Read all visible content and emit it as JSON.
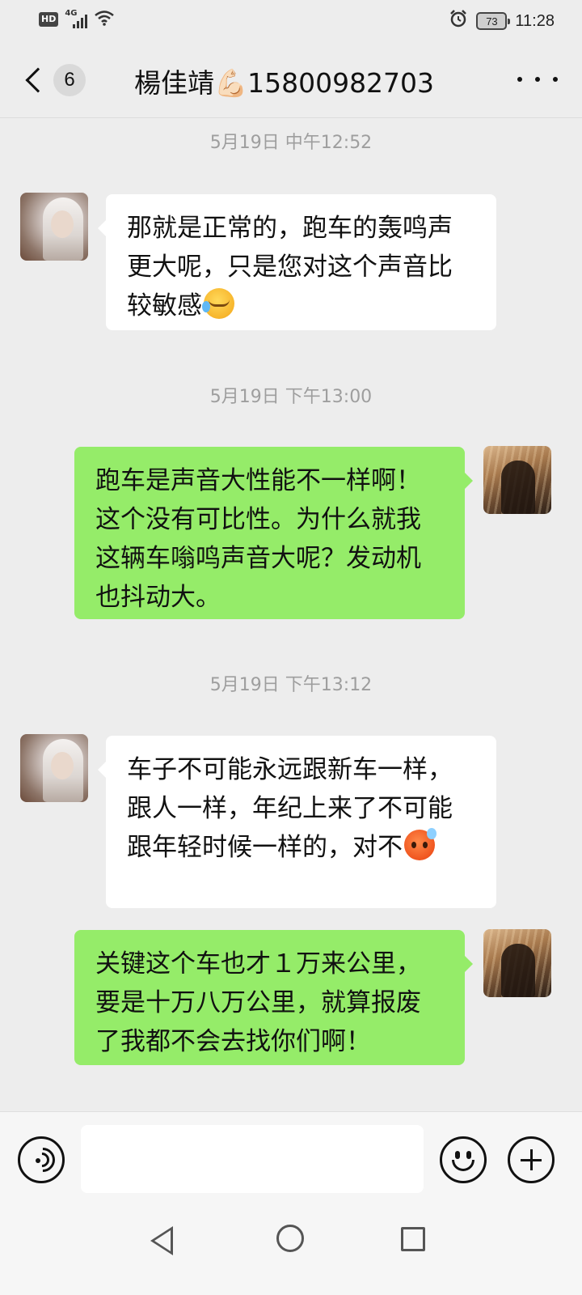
{
  "status_bar": {
    "hd": "HD",
    "network": "4G",
    "battery": "73",
    "time": "11:28"
  },
  "header": {
    "unread_count": "6",
    "title": "楊佳靖💪🏻15800982703"
  },
  "messages": [
    {
      "timestamp": "5月19日 中午12:52",
      "direction": "incoming",
      "text": "那就是正常的，跑车的轰鸣声更大呢，只是您对这个声音比较敏感",
      "emoji": "crying-laughing-emoji"
    },
    {
      "timestamp": "5月19日 下午13:00",
      "direction": "outgoing",
      "text": "跑车是声音大性能不一样啊！这个没有可比性。为什么就我这辆车嗡鸣声音大呢？发动机也抖动大。"
    },
    {
      "timestamp": "5月19日 下午13:12",
      "direction": "incoming",
      "text": "车子不可能永远跟新车一样，跟人一样，年纪上来了不可能跟年轻时候一样的，对不",
      "emoji": "sweating-angry-emoji"
    },
    {
      "direction": "outgoing",
      "text": "关键这个车也才１万来公里，要是十万八万公里，就算报废了我都不会去找你们啊！"
    }
  ],
  "colors": {
    "background": "#ededed",
    "incoming_bubble": "#ffffff",
    "outgoing_bubble": "#95ec69",
    "timestamp": "#9e9e9e"
  }
}
